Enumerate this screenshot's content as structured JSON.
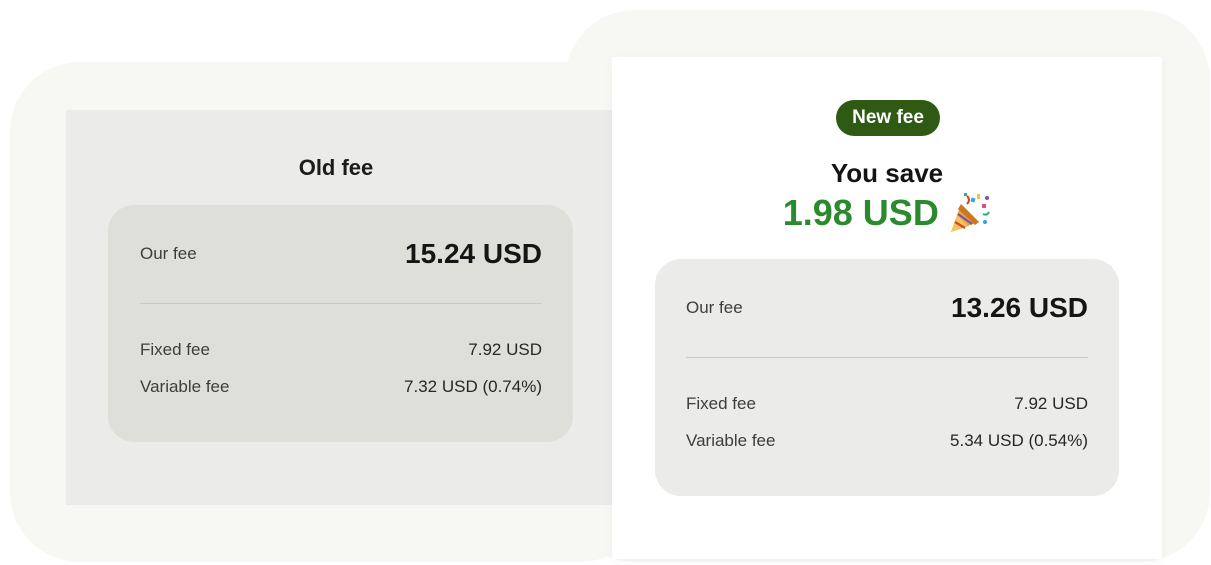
{
  "old_fee": {
    "title": "Old fee",
    "our_fee_label": "Our fee",
    "our_fee_value": "15.24 USD",
    "fixed_fee_label": "Fixed fee",
    "fixed_fee_value": "7.92 USD",
    "variable_fee_label": "Variable fee",
    "variable_fee_value": "7.32 USD (0.74%)"
  },
  "new_fee": {
    "badge": "New fee",
    "save_label": "You save",
    "save_amount": "1.98 USD",
    "save_icon": "party-popper-icon",
    "our_fee_label": "Our fee",
    "our_fee_value": "13.26 USD",
    "fixed_fee_label": "Fixed fee",
    "fixed_fee_value": "7.92 USD",
    "variable_fee_label": "Variable fee",
    "variable_fee_value": "5.34 USD (0.54%)"
  },
  "colors": {
    "badge_bg": "#2f5a14",
    "save_green": "#2b8a2e",
    "old_card_bg": "#ebebe9",
    "old_panel_bg": "#dfdfda",
    "new_panel_bg": "#ebebea"
  }
}
